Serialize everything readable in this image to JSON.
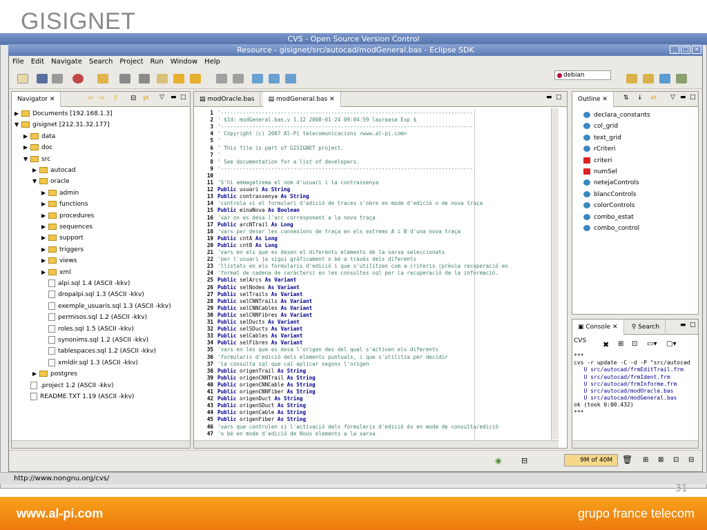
{
  "slide": {
    "title": "GISIGNET",
    "footer_left": "www.al-pi.com",
    "footer_right": "grupo france telecom",
    "page_number": "31"
  },
  "bg_window": {
    "title": "CVS - Open Source Version Control",
    "status_url": "http://www.nongnu.org/cvs/"
  },
  "eclipse": {
    "title": "Resource - gisignet/src/autocad/modGeneral.bas - Eclipse SDK",
    "menu": [
      "File",
      "Edit",
      "Navigate",
      "Search",
      "Project",
      "Run",
      "Window",
      "Help"
    ],
    "debian_label": "debian",
    "navigator": {
      "tab": "Navigator",
      "items": [
        {
          "label": "Documents  [192.168.1.3]",
          "indent": 0,
          "twisty": "▶",
          "type": "folder"
        },
        {
          "label": "gisignet  [212.31.32.177]",
          "indent": 0,
          "twisty": "▼",
          "type": "folder"
        },
        {
          "label": "data",
          "indent": 1,
          "twisty": "▶",
          "type": "folder"
        },
        {
          "label": "doc",
          "indent": 1,
          "twisty": "▶",
          "type": "folder"
        },
        {
          "label": "src",
          "indent": 1,
          "twisty": "▼",
          "type": "folder"
        },
        {
          "label": "autocad",
          "indent": 2,
          "twisty": "▶",
          "type": "folder"
        },
        {
          "label": "oracle",
          "indent": 2,
          "twisty": "▼",
          "type": "folder"
        },
        {
          "label": "admin",
          "indent": 3,
          "twisty": "▶",
          "type": "folder"
        },
        {
          "label": "functions",
          "indent": 3,
          "twisty": "▶",
          "type": "folder"
        },
        {
          "label": "procedures",
          "indent": 3,
          "twisty": "▶",
          "type": "folder"
        },
        {
          "label": "sequences",
          "indent": 3,
          "twisty": "▶",
          "type": "folder"
        },
        {
          "label": "support",
          "indent": 3,
          "twisty": "▶",
          "type": "folder"
        },
        {
          "label": "triggers",
          "indent": 3,
          "twisty": "▶",
          "type": "folder"
        },
        {
          "label": "views",
          "indent": 3,
          "twisty": "▶",
          "type": "folder"
        },
        {
          "label": "xml",
          "indent": 3,
          "twisty": "▶",
          "type": "folder"
        },
        {
          "label": "alpi.sql  1.4  (ASCII -kkv)",
          "indent": 3,
          "twisty": "",
          "type": "file"
        },
        {
          "label": "dropalpi.sql  1.3  (ASCII -kkv)",
          "indent": 3,
          "twisty": "",
          "type": "file"
        },
        {
          "label": "exemple_usuaris.sql  1.3  (ASCII -kkv)",
          "indent": 3,
          "twisty": "",
          "type": "file"
        },
        {
          "label": "permisos.sql  1.2  (ASCII -kkv)",
          "indent": 3,
          "twisty": "",
          "type": "file"
        },
        {
          "label": "roles.sql  1.5  (ASCII -kkv)",
          "indent": 3,
          "twisty": "",
          "type": "file"
        },
        {
          "label": "synonims.sql  1.2  (ASCII -kkv)",
          "indent": 3,
          "twisty": "",
          "type": "file"
        },
        {
          "label": "tablespaces.sql  1.2  (ASCII -kkv)",
          "indent": 3,
          "twisty": "",
          "type": "file"
        },
        {
          "label": "xmldir.sql  1.3  (ASCII -kkv)",
          "indent": 3,
          "twisty": "",
          "type": "file"
        },
        {
          "label": "postgres",
          "indent": 2,
          "twisty": "▶",
          "type": "folder"
        },
        {
          "label": ".project  1.2  (ASCII -kkv)",
          "indent": 1,
          "twisty": "",
          "type": "file"
        },
        {
          "label": "README.TXT  1.19  (ASCII -kkv)",
          "indent": 1,
          "twisty": "",
          "type": "file"
        }
      ]
    },
    "editor": {
      "tabs": [
        "modOracle.bas",
        "modGeneral.bas"
      ],
      "lines": [
        {
          "n": "1",
          "t": "'--------------------------------------------------------------------------------",
          "k": false
        },
        {
          "n": "2",
          "t": "' $Id: modGeneral.bas,v 1.12 2008-01-24 09:04:59 lauraasa Exp $",
          "k": false
        },
        {
          "n": "3",
          "t": "'--------------------------------------------------------------------------------",
          "k": false
        },
        {
          "n": "4",
          "t": "' Copyright (c) 2007 Al-Pi telecomunicacions <www.al-pi.com>",
          "k": false
        },
        {
          "n": "5",
          "t": "'",
          "k": false
        },
        {
          "n": "6",
          "t": "' This file is part of GISIGNET project.",
          "k": false
        },
        {
          "n": "7",
          "t": "'",
          "k": false
        },
        {
          "n": "8",
          "t": "' See documentation for a list of developers.",
          "k": false
        },
        {
          "n": "9",
          "t": "'--------------------------------------------------------------------------------",
          "k": false
        },
        {
          "n": "10",
          "t": "",
          "k": false
        },
        {
          "n": "11",
          "t": "'S'hi emmagatzema el nom d'usuari i la contrassenya",
          "k": false
        },
        {
          "n": "12",
          "t": "Public usuari As String",
          "k": true
        },
        {
          "n": "13",
          "t": "Public contrassenya As String",
          "k": true
        },
        {
          "n": "14",
          "t": "'controla si el formulari d'edició de traces s'obre en mode d'edició o de nova traça",
          "k": false
        },
        {
          "n": "15",
          "t": "Public einaNova As Boolean",
          "k": true
        },
        {
          "n": "16",
          "t": "'var on es desa l'arc corresponent a la nova traça",
          "k": false
        },
        {
          "n": "17",
          "t": "Public arcNTrail As Long",
          "k": true
        },
        {
          "n": "18",
          "t": "'vars per desar les connexions de traça en els extrems A i B d'una nova traça",
          "k": false
        },
        {
          "n": "19",
          "t": "Public cntA As Long",
          "k": true
        },
        {
          "n": "20",
          "t": "Public cntB As Long",
          "k": true
        },
        {
          "n": "21",
          "t": "'vars en els que es desen el diferents elements de la xarxa seleccionats",
          "k": false
        },
        {
          "n": "22",
          "t": "'per l'usuari ja sigui gràficament o bé a través dels diferents",
          "k": false
        },
        {
          "n": "23",
          "t": "'llistats en els formularis d'edició i que s'utilitzen com a criteris (prèvia recuperació en",
          "k": false
        },
        {
          "n": "24",
          "t": "'format de cadena de caràcters) en les consultes sql per la recuperació de la informació.",
          "k": false
        },
        {
          "n": "25",
          "t": "Public selArcs As Variant",
          "k": true
        },
        {
          "n": "26",
          "t": "Public selNodes As Variant",
          "k": true
        },
        {
          "n": "27",
          "t": "Public selTrails As Variant",
          "k": true
        },
        {
          "n": "28",
          "t": "Public selCNNTrails As Variant",
          "k": true
        },
        {
          "n": "29",
          "t": "Public selCNNCables As Variant",
          "k": true
        },
        {
          "n": "30",
          "t": "Public selCNNFibres As Variant",
          "k": true
        },
        {
          "n": "31",
          "t": "Public selDucts As Variant",
          "k": true
        },
        {
          "n": "32",
          "t": "Public selSDucts As Variant",
          "k": true
        },
        {
          "n": "33",
          "t": "Public selCables As Variant",
          "k": true
        },
        {
          "n": "34",
          "t": "Public selFibres As Variant",
          "k": true
        },
        {
          "n": "35",
          "t": "'vars en les que es desa l'origen des del qual s'activen els diferents",
          "k": false
        },
        {
          "n": "36",
          "t": "'formularis d'edició dels elements puntuals, i que s'utilitza per decidir",
          "k": false
        },
        {
          "n": "37",
          "t": "'la consulta sql que cal aplicar segons l'origen",
          "k": false
        },
        {
          "n": "38",
          "t": "Public origenTrail As String",
          "k": true
        },
        {
          "n": "39",
          "t": "Public origenCNNTrail As String",
          "k": true
        },
        {
          "n": "40",
          "t": "Public origenCNNCable As String",
          "k": true
        },
        {
          "n": "41",
          "t": "Public origenCNNFiber As String",
          "k": true
        },
        {
          "n": "42",
          "t": "Public origenDuct As String",
          "k": true
        },
        {
          "n": "43",
          "t": "Public origenSDuct As String",
          "k": true
        },
        {
          "n": "44",
          "t": "Public origenCable As String",
          "k": true
        },
        {
          "n": "45",
          "t": "Public origenFiber As String",
          "k": true
        },
        {
          "n": "46",
          "t": "'vars que controlen si l'activació dels formularis d'edició és en mode de consulta/edició",
          "k": false
        },
        {
          "n": "47",
          "t": "'o bé en mode d'edició de Nous elements a la xarxa",
          "k": false
        }
      ]
    },
    "outline": {
      "tab": "Outline",
      "items": [
        {
          "label": "declara_constants",
          "red": false
        },
        {
          "label": "col_grid",
          "red": false
        },
        {
          "label": "text_grid",
          "red": false
        },
        {
          "label": "rCriteri",
          "red": false
        },
        {
          "label": "criteri",
          "red": true
        },
        {
          "label": "numSel",
          "red": true
        },
        {
          "label": "netejaControls",
          "red": false
        },
        {
          "label": "blancControls",
          "red": false
        },
        {
          "label": "colorControls",
          "red": false
        },
        {
          "label": "combo_estat",
          "red": false
        },
        {
          "label": "combo_control",
          "red": false
        }
      ]
    },
    "console": {
      "tabs": [
        "Console",
        "Search"
      ],
      "header": "CVS",
      "lines": [
        {
          "t": "***",
          "blue": false
        },
        {
          "t": "cvs -r update -C -d -P \"src/autocad",
          "blue": false
        },
        {
          "t": "   U src/autocad/frmEditTrail.frm",
          "blue": true
        },
        {
          "t": "   U src/autocad/frmIdent.frm",
          "blue": true
        },
        {
          "t": "   U src/autocad/frmInforme.frm",
          "blue": true
        },
        {
          "t": "   U src/autocad/modOracle.bas",
          "blue": true
        },
        {
          "t": "   U src/autocad/modGeneral.bas",
          "blue": true
        },
        {
          "t": "ok (took 0:00.432)",
          "blue": false
        },
        {
          "t": "***",
          "blue": false
        }
      ]
    },
    "status": {
      "memory": "9M of 40M"
    }
  }
}
